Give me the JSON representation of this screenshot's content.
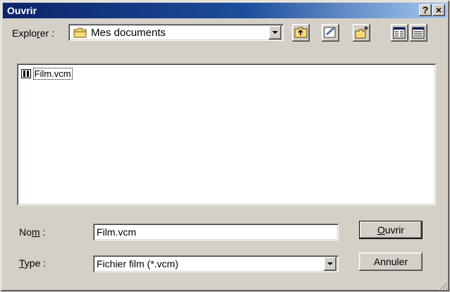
{
  "window": {
    "title": "Ouvrir",
    "help_label": "?",
    "close_label": "×"
  },
  "toolbar": {
    "look_in_label_pre": "Explo",
    "look_in_label_accel": "r",
    "look_in_label_post": "er :",
    "look_in_value": "Mes documents"
  },
  "file_list": {
    "items": [
      {
        "name": "Film.vcm"
      }
    ]
  },
  "filename": {
    "label_pre": "No",
    "label_accel": "m",
    "label_post": " :",
    "value": "Film.vcm"
  },
  "filetype": {
    "label_accel": "T",
    "label_post": "ype :",
    "value": "Fichier film (*.vcm)"
  },
  "buttons": {
    "open_accel": "O",
    "open_rest": "uvrir",
    "cancel": "Annuler"
  }
}
